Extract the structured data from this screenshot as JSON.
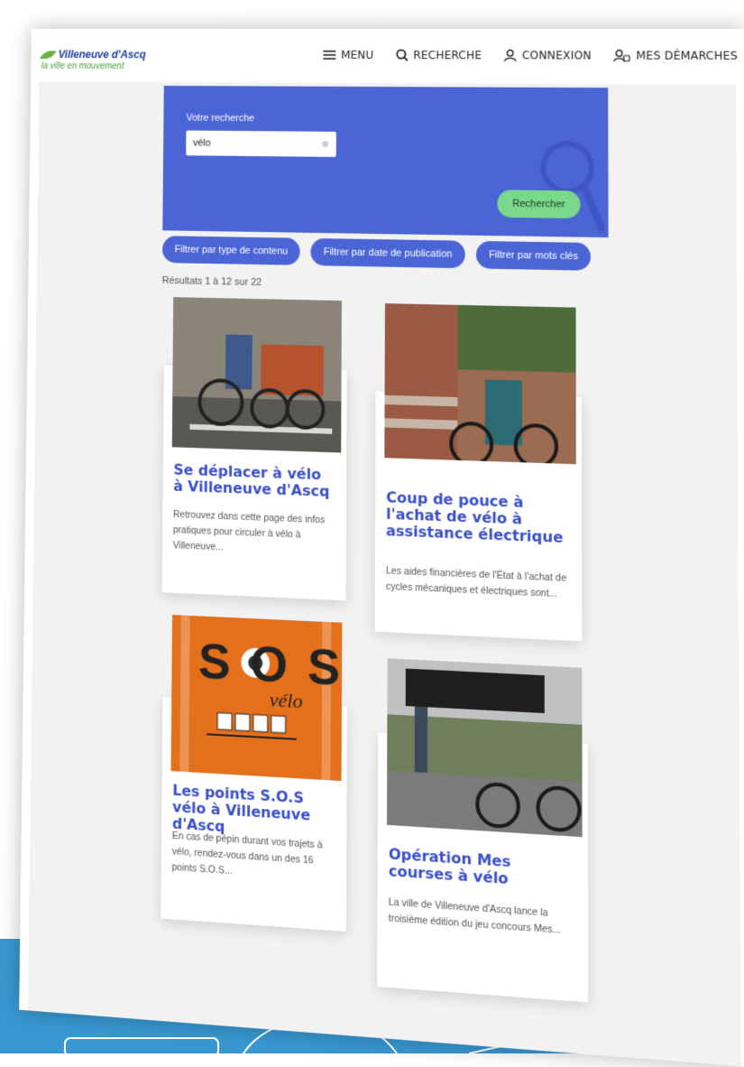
{
  "header": {
    "logo_brand": "Villeneuve d'Ascq",
    "logo_tagline": "la ville en mouvement",
    "nav": [
      {
        "label": "MENU",
        "icon": "menu-icon"
      },
      {
        "label": "RECHERCHE",
        "icon": "search-icon"
      },
      {
        "label": "CONNEXION",
        "icon": "user-icon"
      },
      {
        "label": "MES DÉMARCHES",
        "icon": "user-badge-icon"
      }
    ]
  },
  "search": {
    "label": "Votre recherche",
    "value": "vélo",
    "submit_label": "Rechercher"
  },
  "filters": [
    "Filtrer par type de contenu",
    "Filtrer par date de publication",
    "Filtrer par mots clés"
  ],
  "results_text": "Résultats 1 à 12 sur 22",
  "cards": [
    {
      "title": "Se déplacer à vélo à Villeneuve d'Ascq",
      "description": "Retrouvez dans cette page des infos pratiques pour circuler à vélo à Villeneuve...",
      "image": "cargo-bike-photo"
    },
    {
      "title": "Coup de pouce à l'achat de vélo à assistance électrique",
      "description": "Les aides financières de l'État à l'achat de cycles mécaniques et électriques sont...",
      "image": "electric-bike-photo"
    },
    {
      "title": "Les points S.O.S vélo à Villeneuve d'Ascq",
      "description": "En cas de pépin durant vos trajets à vélo, rendez-vous dans un des 16 points S.O.S...",
      "image": "sos-velo-logo",
      "image_text": "SOS",
      "image_subtext": "vélo"
    },
    {
      "title": "Opération Mes courses à vélo",
      "description": "La ville de Villeneuve d'Ascq lance la troisième édition du jeu concours Mes...",
      "image": "street-bike-photo"
    }
  ],
  "colors": {
    "primary": "#4b64d6",
    "accent_green": "#7ad88a",
    "title_blue": "#3a4fc9",
    "band_blue": "#3898d2",
    "sos_orange": "#e5701b"
  }
}
